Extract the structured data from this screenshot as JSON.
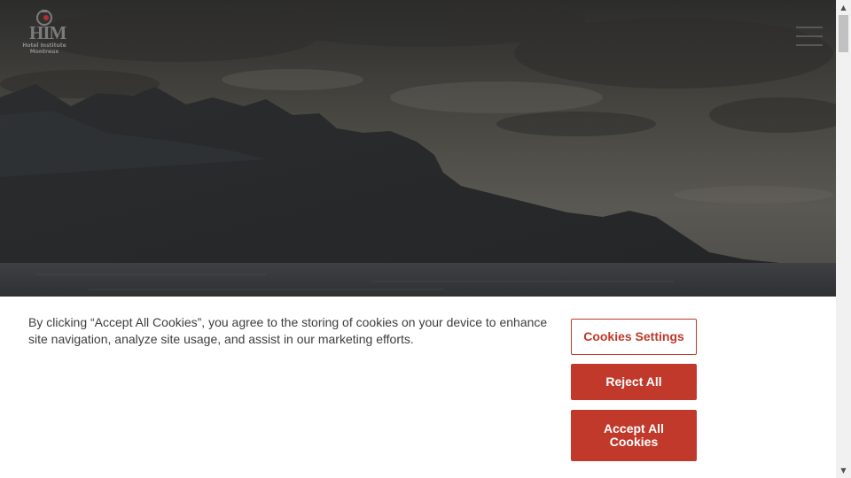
{
  "header": {
    "logo_letters": "HIM",
    "logo_line1": "Hotel Institute",
    "logo_line2": "Montreux",
    "menu_icon": "hamburger-icon"
  },
  "cookie_banner": {
    "message": "By clicking “Accept All Cookies”, you agree to the storing of cookies on your device to enhance site navigation, analyze site usage, and assist in our marketing efforts.",
    "settings_label": "Cookies Settings",
    "reject_label": "Reject All",
    "accept_label": "Accept All Cookies"
  },
  "scrollbar": {
    "up_glyph": "▲",
    "down_glyph": "▼"
  },
  "colors": {
    "accent": "#c0392b",
    "banner_bg": "#ffffff",
    "text": "#3d3d3d"
  }
}
